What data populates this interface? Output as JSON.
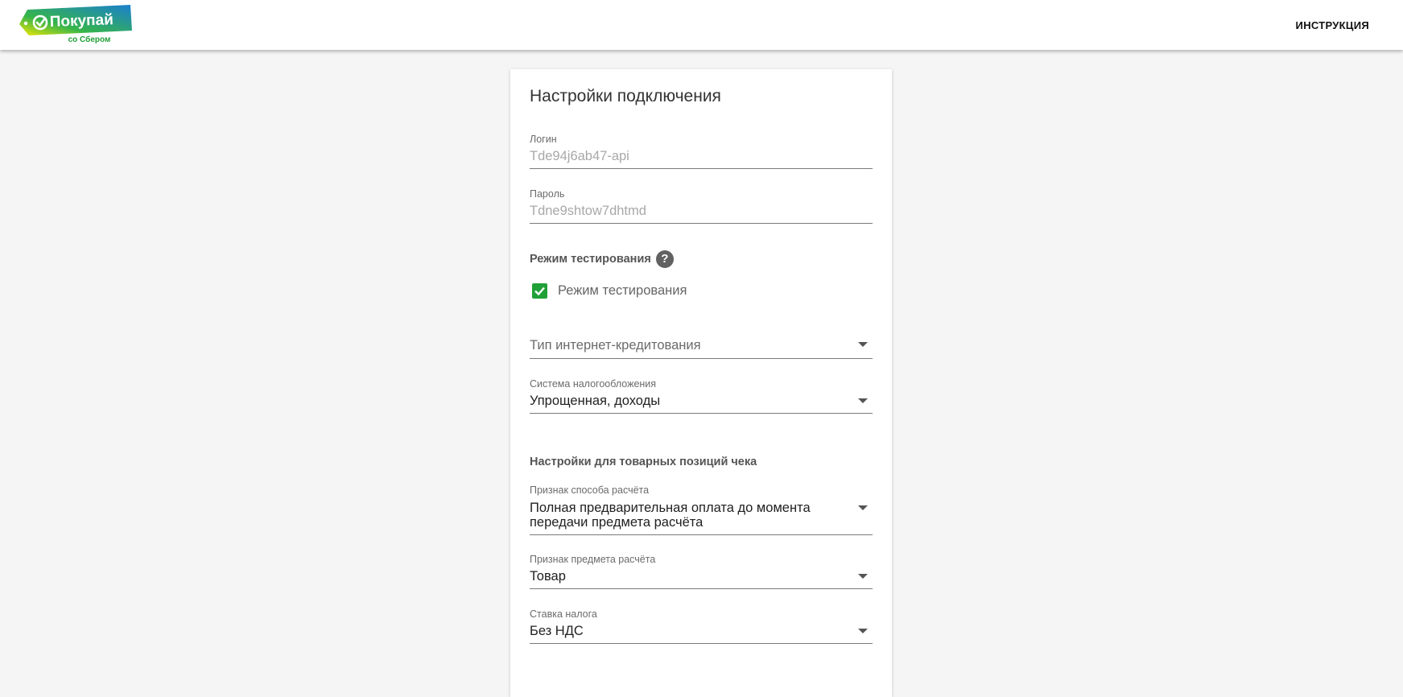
{
  "header": {
    "logo_text": "Покупай",
    "logo_sub": "со Сбером",
    "instruction_label": "ИНСТРУКЦИЯ"
  },
  "card": {
    "title": "Настройки подключения",
    "login": {
      "label": "Логин",
      "value": "Tde94j6ab47-api"
    },
    "password": {
      "label": "Пароль",
      "value": "Tdne9shtow7dhtmd"
    },
    "test_mode": {
      "section_label": "Режим тестирования",
      "checkbox_label": "Режим тестирования",
      "checked": true
    },
    "credit_type": {
      "placeholder": "Тип интернет-кредитования"
    },
    "tax_system": {
      "label": "Система налогообложения",
      "value": "Упрощенная, доходы"
    },
    "receipt_section": "Настройки для товарных позиций чека",
    "payment_method": {
      "label": "Признак способа расчёта",
      "value_line1": "Полная предварительная оплата до момента",
      "value_line2": "передачи предмета расчёта"
    },
    "payment_object": {
      "label": "Признак предмета расчёта",
      "value": "Товар"
    },
    "vat": {
      "label": "Ставка налога",
      "value": "Без НДС"
    }
  },
  "colors": {
    "accent_green": "#21a038",
    "logo_blue": "#1a8cd8",
    "logo_yellow": "#f2e700"
  },
  "icons": [
    "help-icon",
    "check-icon",
    "chevron-down-icon",
    "logo-check-icon"
  ]
}
